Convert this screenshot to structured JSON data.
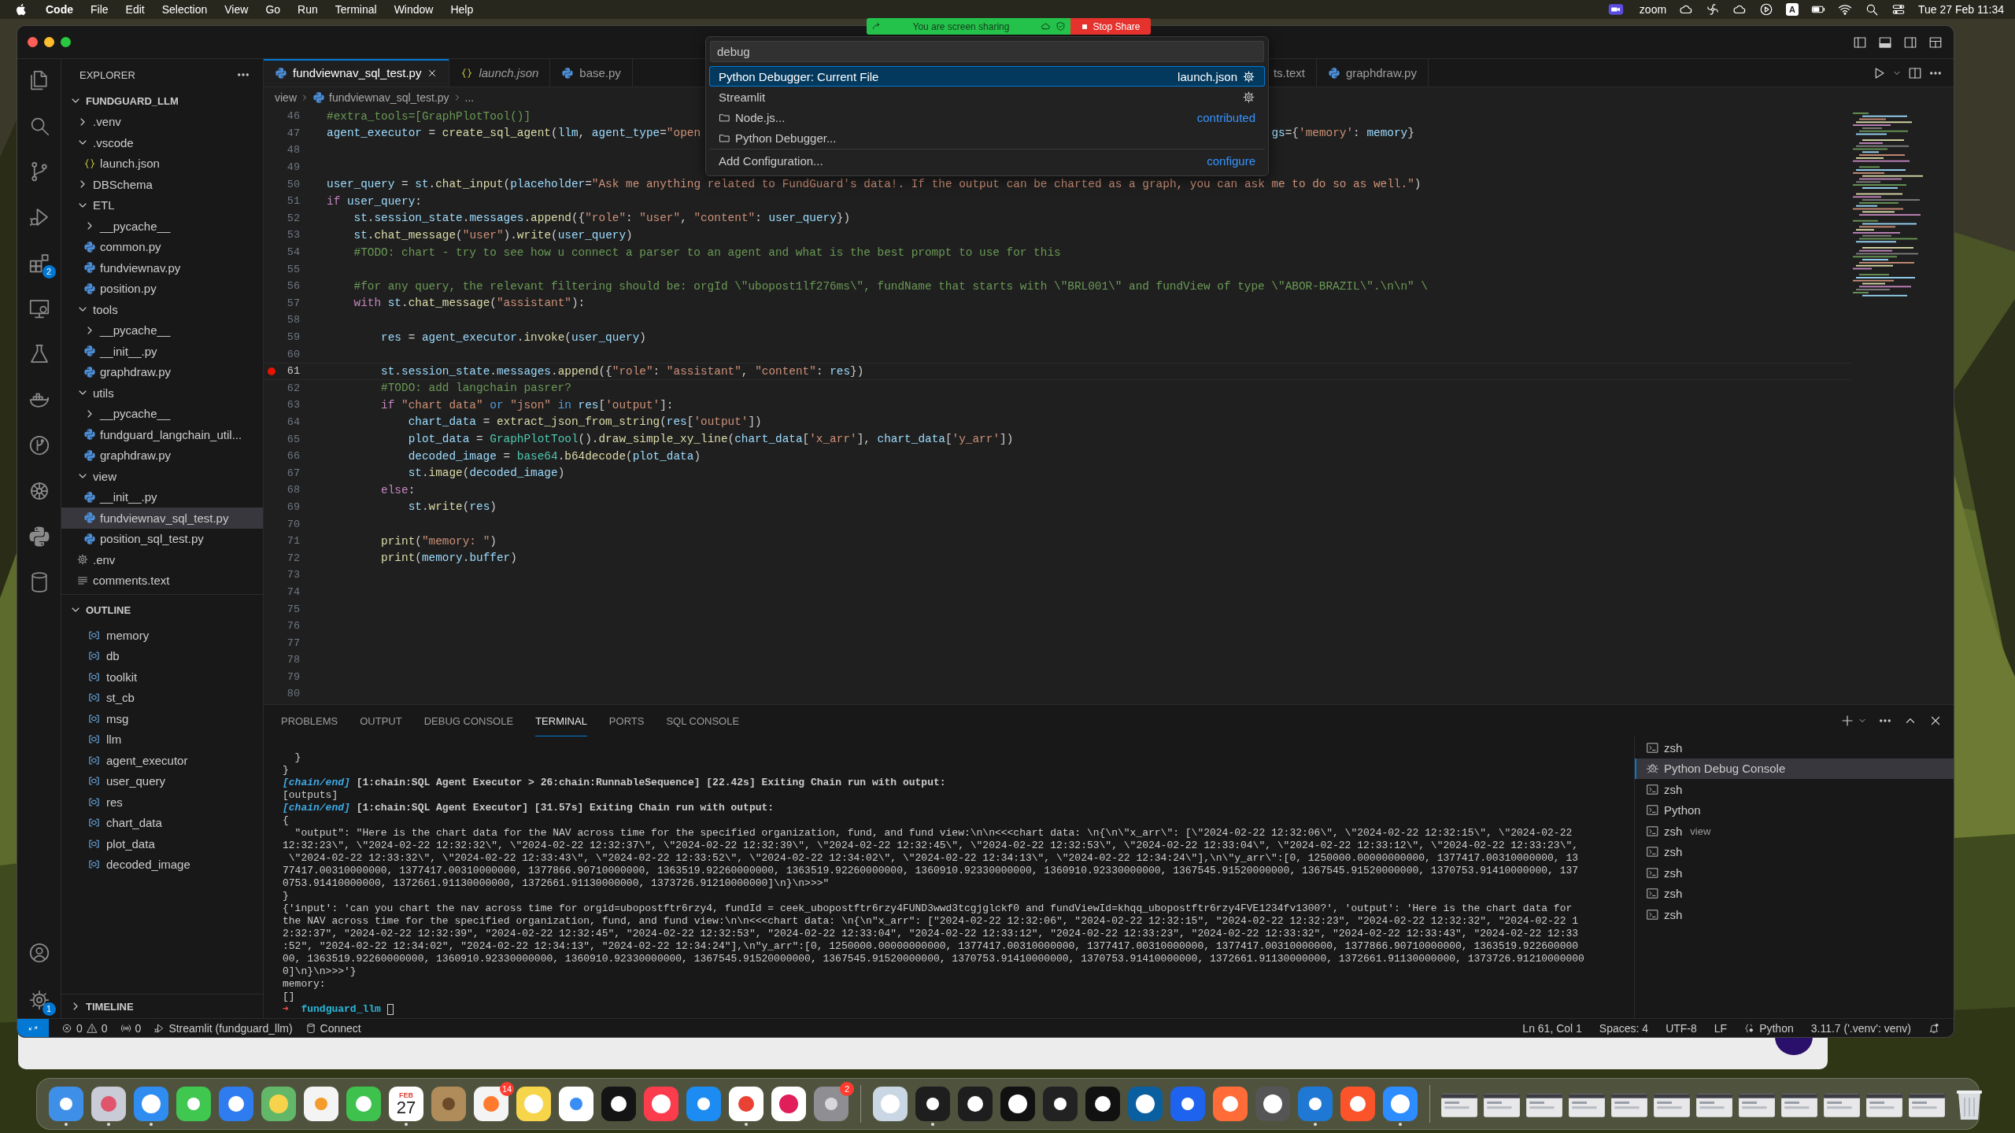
{
  "menu_bar": {
    "app": "Code",
    "menus": [
      "File",
      "Edit",
      "Selection",
      "View",
      "Go",
      "Run",
      "Terminal",
      "Window",
      "Help"
    ],
    "zoom_label": "zoom",
    "input_source": "A",
    "clock": "Tue 27 Feb 11:34"
  },
  "screen_share": {
    "message": "You are screen sharing",
    "stop_button": "Stop Share"
  },
  "activity_bar": {
    "extensions_badge": "2",
    "settings_badge": "1"
  },
  "explorer": {
    "title": "EXPLORER",
    "tree": {
      "label": "FUNDGUARD_LLM",
      "kind": "root",
      "expanded": true,
      "selected": false,
      "children": [
        {
          "label": ".venv",
          "kind": "folder",
          "expanded": false,
          "selected": false
        },
        {
          "label": ".vscode",
          "kind": "folder",
          "expanded": true,
          "selected": false,
          "children": [
            {
              "label": "launch.json",
              "kind": "json",
              "selected": false
            }
          ]
        },
        {
          "label": "DBSchema",
          "kind": "folder",
          "expanded": false,
          "selected": false
        },
        {
          "label": "ETL",
          "kind": "folder",
          "expanded": true,
          "selected": false,
          "children": [
            {
              "label": "__pycache__",
              "kind": "folder",
              "expanded": false,
              "selected": false
            },
            {
              "label": "common.py",
              "kind": "python",
              "selected": false
            },
            {
              "label": "fundviewnav.py",
              "kind": "python",
              "selected": false
            },
            {
              "label": "position.py",
              "kind": "python",
              "selected": false
            }
          ]
        },
        {
          "label": "tools",
          "kind": "folder",
          "expanded": true,
          "selected": false,
          "children": [
            {
              "label": "__pycache__",
              "kind": "folder",
              "expanded": false,
              "selected": false
            },
            {
              "label": "__init__.py",
              "kind": "python",
              "selected": false
            },
            {
              "label": "graphdraw.py",
              "kind": "python",
              "selected": false
            }
          ]
        },
        {
          "label": "utils",
          "kind": "folder",
          "expanded": true,
          "selected": false,
          "children": [
            {
              "label": "__pycache__",
              "kind": "folder",
              "expanded": false,
              "selected": false
            },
            {
              "label": "fundguard_langchain_util...",
              "kind": "python",
              "selected": false
            },
            {
              "label": "graphdraw.py",
              "kind": "python",
              "selected": false
            }
          ]
        },
        {
          "label": "view",
          "kind": "folder",
          "expanded": true,
          "selected": false,
          "children": [
            {
              "label": "__init__.py",
              "kind": "python",
              "selected": false
            },
            {
              "label": "fundviewnav_sql_test.py",
              "kind": "python",
              "selected": true
            },
            {
              "label": "position_sql_test.py",
              "kind": "python",
              "selected": false
            }
          ]
        },
        {
          "label": ".env",
          "kind": "env",
          "selected": false
        },
        {
          "label": "comments.text",
          "kind": "text",
          "selected": false
        }
      ]
    }
  },
  "outline": {
    "title": "OUTLINE",
    "expanded": true,
    "items": [
      "memory",
      "db",
      "toolkit",
      "st_cb",
      "msg",
      "llm",
      "agent_executor",
      "user_query",
      "res",
      "chart_data",
      "plot_data",
      "decoded_image"
    ]
  },
  "timeline": {
    "title": "TIMELINE",
    "expanded": false
  },
  "tabs": [
    {
      "label": "fundviewnav_sql_test.py",
      "kind": "python",
      "selected": true,
      "preview": false
    },
    {
      "label": "launch.json",
      "kind": "json",
      "selected": false,
      "preview": true
    },
    {
      "label": "base.py",
      "kind": "python",
      "selected": false,
      "preview": false
    },
    {
      "label": "ts.text",
      "kind": "partial",
      "selected": false,
      "preview": false
    },
    {
      "label": "graphdraw.py",
      "kind": "python",
      "selected": false,
      "preview": false
    }
  ],
  "breadcrumbs": [
    {
      "label": "view",
      "kind": "folder"
    },
    {
      "label": "fundviewnav_sql_test.py",
      "kind": "python"
    },
    {
      "label": "...",
      "kind": "symbol"
    }
  ],
  "command_palette": {
    "query": "debug",
    "items": [
      {
        "label": "Python Debugger: Current File",
        "detail": "launch.json",
        "kind": "config",
        "selected": true
      },
      {
        "label": "Streamlit",
        "kind": "config",
        "selected": false
      },
      {
        "label": "Node.js...",
        "detail": "contributed",
        "kind": "folder",
        "selected": false
      },
      {
        "label": "Python Debugger...",
        "kind": "folder",
        "selected": false
      },
      {
        "label": "Add Configuration...",
        "detail": "configure",
        "kind": "action",
        "selected": false
      }
    ]
  },
  "editor": {
    "lines": [
      {
        "number": "46",
        "breakpoint": false,
        "current": false,
        "tokens": [
          {
            "kind": "comment",
            "text": "#extra_tools=[GraphPlotTool()]"
          }
        ]
      },
      {
        "number": "47",
        "breakpoint": false,
        "current": false,
        "tokens": [
          {
            "kind": "variable",
            "text": "agent_executor"
          },
          {
            "kind": "plain",
            "text": " = "
          },
          {
            "kind": "function",
            "text": "create_sql_agent"
          },
          {
            "kind": "plain",
            "text": "("
          },
          {
            "kind": "variable",
            "text": "llm"
          },
          {
            "kind": "plain",
            "text": ", "
          },
          {
            "kind": "variable",
            "text": "agent_type"
          },
          {
            "kind": "plain",
            "text": "="
          },
          {
            "kind": "string",
            "text": "\"open"
          }
        ],
        "tokens_right": [
          {
            "kind": "variable",
            "text": "gs"
          },
          {
            "kind": "plain",
            "text": "={"
          },
          {
            "kind": "string",
            "text": "'memory'"
          },
          {
            "kind": "plain",
            "text": ": "
          },
          {
            "kind": "variable",
            "text": "memory"
          },
          {
            "kind": "plain",
            "text": "}"
          }
        ]
      },
      {
        "number": "48",
        "breakpoint": false,
        "current": false
      },
      {
        "number": "49",
        "breakpoint": false,
        "current": false
      },
      {
        "number": "50",
        "breakpoint": false,
        "current": false,
        "tokens": [
          {
            "kind": "variable",
            "text": "user_query"
          },
          {
            "kind": "plain",
            "text": " = "
          },
          {
            "kind": "variable",
            "text": "st"
          },
          {
            "kind": "plain",
            "text": "."
          },
          {
            "kind": "function",
            "text": "chat_input"
          },
          {
            "kind": "plain",
            "text": "("
          },
          {
            "kind": "variable",
            "text": "placeholder"
          },
          {
            "kind": "plain",
            "text": "="
          },
          {
            "kind": "string",
            "text": "\"Ask me anything related to FundGuard's data!. If the output can be charted as a graph, you can ask me to do so as well.\""
          },
          {
            "kind": "plain",
            "text": ")"
          }
        ]
      },
      {
        "number": "51",
        "breakpoint": false,
        "current": false,
        "tokens": [
          {
            "kind": "keyword",
            "text": "if "
          },
          {
            "kind": "variable",
            "text": "user_query"
          },
          {
            "kind": "plain",
            "text": ":"
          }
        ]
      },
      {
        "number": "52",
        "breakpoint": false,
        "current": false,
        "tokens": [
          {
            "kind": "variable",
            "text": "    st"
          },
          {
            "kind": "plain",
            "text": "."
          },
          {
            "kind": "variable",
            "text": "session_state"
          },
          {
            "kind": "plain",
            "text": "."
          },
          {
            "kind": "variable",
            "text": "messages"
          },
          {
            "kind": "plain",
            "text": "."
          },
          {
            "kind": "function",
            "text": "append"
          },
          {
            "kind": "plain",
            "text": "({"
          },
          {
            "kind": "string",
            "text": "\"role\""
          },
          {
            "kind": "plain",
            "text": ": "
          },
          {
            "kind": "string",
            "text": "\"user\""
          },
          {
            "kind": "plain",
            "text": ", "
          },
          {
            "kind": "string",
            "text": "\"content\""
          },
          {
            "kind": "plain",
            "text": ": "
          },
          {
            "kind": "variable",
            "text": "user_query"
          },
          {
            "kind": "plain",
            "text": "})"
          }
        ]
      },
      {
        "number": "53",
        "breakpoint": false,
        "current": false,
        "tokens": [
          {
            "kind": "variable",
            "text": "    st"
          },
          {
            "kind": "plain",
            "text": "."
          },
          {
            "kind": "function",
            "text": "chat_message"
          },
          {
            "kind": "plain",
            "text": "("
          },
          {
            "kind": "string",
            "text": "\"user\""
          },
          {
            "kind": "plain",
            "text": ")."
          },
          {
            "kind": "function",
            "text": "write"
          },
          {
            "kind": "plain",
            "text": "("
          },
          {
            "kind": "variable",
            "text": "user_query"
          },
          {
            "kind": "plain",
            "text": ")"
          }
        ]
      },
      {
        "number": "54",
        "breakpoint": false,
        "current": false,
        "tokens": [
          {
            "kind": "comment",
            "text": "    #TODO: chart - try to see how u connect a parser to an agent and what is the best prompt to use for this"
          }
        ]
      },
      {
        "number": "55",
        "breakpoint": false,
        "current": false
      },
      {
        "number": "56",
        "breakpoint": false,
        "current": false,
        "tokens": [
          {
            "kind": "comment",
            "text": "    #for any query, the relevant filtering should be: orgId \\\"ubopost1lf276ms\\\", fundName that starts with \\\"BRL001\\\" and fundView of type \\\"ABOR-BRAZIL\\\".\\n\\n\" \\"
          }
        ]
      },
      {
        "number": "57",
        "breakpoint": false,
        "current": false,
        "tokens": [
          {
            "kind": "keyword",
            "text": "    with "
          },
          {
            "kind": "variable",
            "text": "st"
          },
          {
            "kind": "plain",
            "text": "."
          },
          {
            "kind": "function",
            "text": "chat_message"
          },
          {
            "kind": "plain",
            "text": "("
          },
          {
            "kind": "string",
            "text": "\"assistant\""
          },
          {
            "kind": "plain",
            "text": "):"
          }
        ]
      },
      {
        "number": "58",
        "breakpoint": false,
        "current": false
      },
      {
        "number": "59",
        "breakpoint": false,
        "current": false,
        "tokens": [
          {
            "kind": "variable",
            "text": "        res"
          },
          {
            "kind": "plain",
            "text": " = "
          },
          {
            "kind": "variable",
            "text": "agent_executor"
          },
          {
            "kind": "plain",
            "text": "."
          },
          {
            "kind": "function",
            "text": "invoke"
          },
          {
            "kind": "plain",
            "text": "("
          },
          {
            "kind": "variable",
            "text": "user_query"
          },
          {
            "kind": "plain",
            "text": ")"
          }
        ]
      },
      {
        "number": "60",
        "breakpoint": false,
        "current": false
      },
      {
        "number": "61",
        "breakpoint": true,
        "current": true,
        "tokens": [
          {
            "kind": "variable",
            "text": "        st"
          },
          {
            "kind": "plain",
            "text": "."
          },
          {
            "kind": "variable",
            "text": "session_state"
          },
          {
            "kind": "plain",
            "text": "."
          },
          {
            "kind": "variable",
            "text": "messages"
          },
          {
            "kind": "plain",
            "text": "."
          },
          {
            "kind": "function",
            "text": "append"
          },
          {
            "kind": "plain",
            "text": "({"
          },
          {
            "kind": "string",
            "text": "\"role\""
          },
          {
            "kind": "plain",
            "text": ": "
          },
          {
            "kind": "string",
            "text": "\"assistant\""
          },
          {
            "kind": "plain",
            "text": ", "
          },
          {
            "kind": "string",
            "text": "\"content\""
          },
          {
            "kind": "plain",
            "text": ": "
          },
          {
            "kind": "variable",
            "text": "res"
          },
          {
            "kind": "plain",
            "text": "})"
          }
        ]
      },
      {
        "number": "62",
        "breakpoint": false,
        "current": false,
        "tokens": [
          {
            "kind": "comment",
            "text": "        #TODO: add langchain pasrer?"
          }
        ]
      },
      {
        "number": "63",
        "breakpoint": false,
        "current": false,
        "tokens": [
          {
            "kind": "keyword",
            "text": "        if "
          },
          {
            "kind": "string",
            "text": "\"chart data\""
          },
          {
            "kind": "operator",
            "text": " or "
          },
          {
            "kind": "string",
            "text": "\"json\""
          },
          {
            "kind": "operator",
            "text": " in "
          },
          {
            "kind": "variable",
            "text": "res"
          },
          {
            "kind": "plain",
            "text": "["
          },
          {
            "kind": "string",
            "text": "'output'"
          },
          {
            "kind": "plain",
            "text": "]:"
          }
        ]
      },
      {
        "number": "64",
        "breakpoint": false,
        "current": false,
        "tokens": [
          {
            "kind": "variable",
            "text": "            chart_data"
          },
          {
            "kind": "plain",
            "text": " = "
          },
          {
            "kind": "function",
            "text": "extract_json_from_string"
          },
          {
            "kind": "plain",
            "text": "("
          },
          {
            "kind": "variable",
            "text": "res"
          },
          {
            "kind": "plain",
            "text": "["
          },
          {
            "kind": "string",
            "text": "'output'"
          },
          {
            "kind": "plain",
            "text": "])"
          }
        ]
      },
      {
        "number": "65",
        "breakpoint": false,
        "current": false,
        "tokens": [
          {
            "kind": "variable",
            "text": "            plot_data"
          },
          {
            "kind": "plain",
            "text": " = "
          },
          {
            "kind": "class",
            "text": "GraphPlotTool"
          },
          {
            "kind": "plain",
            "text": "()."
          },
          {
            "kind": "function",
            "text": "draw_simple_xy_line"
          },
          {
            "kind": "plain",
            "text": "("
          },
          {
            "kind": "variable",
            "text": "chart_data"
          },
          {
            "kind": "plain",
            "text": "["
          },
          {
            "kind": "string",
            "text": "'x_arr'"
          },
          {
            "kind": "plain",
            "text": "], "
          },
          {
            "kind": "variable",
            "text": "chart_data"
          },
          {
            "kind": "plain",
            "text": "["
          },
          {
            "kind": "string",
            "text": "'y_arr'"
          },
          {
            "kind": "plain",
            "text": "])"
          }
        ]
      },
      {
        "number": "66",
        "breakpoint": false,
        "current": false,
        "tokens": [
          {
            "kind": "variable",
            "text": "            decoded_image"
          },
          {
            "kind": "plain",
            "text": " = "
          },
          {
            "kind": "class",
            "text": "base64"
          },
          {
            "kind": "plain",
            "text": "."
          },
          {
            "kind": "function",
            "text": "b64decode"
          },
          {
            "kind": "plain",
            "text": "("
          },
          {
            "kind": "variable",
            "text": "plot_data"
          },
          {
            "kind": "plain",
            "text": ")"
          }
        ]
      },
      {
        "number": "67",
        "breakpoint": false,
        "current": false,
        "tokens": [
          {
            "kind": "variable",
            "text": "            st"
          },
          {
            "kind": "plain",
            "text": "."
          },
          {
            "kind": "function",
            "text": "image"
          },
          {
            "kind": "plain",
            "text": "("
          },
          {
            "kind": "variable",
            "text": "decoded_image"
          },
          {
            "kind": "plain",
            "text": ")"
          }
        ]
      },
      {
        "number": "68",
        "breakpoint": false,
        "current": false,
        "tokens": [
          {
            "kind": "keyword",
            "text": "        else"
          },
          {
            "kind": "plain",
            "text": ":"
          }
        ]
      },
      {
        "number": "69",
        "breakpoint": false,
        "current": false,
        "tokens": [
          {
            "kind": "variable",
            "text": "            st"
          },
          {
            "kind": "plain",
            "text": "."
          },
          {
            "kind": "function",
            "text": "write"
          },
          {
            "kind": "plain",
            "text": "("
          },
          {
            "kind": "variable",
            "text": "res"
          },
          {
            "kind": "plain",
            "text": ")"
          }
        ]
      },
      {
        "number": "70",
        "breakpoint": false,
        "current": false
      },
      {
        "number": "71",
        "breakpoint": false,
        "current": false,
        "tokens": [
          {
            "kind": "function",
            "text": "        print"
          },
          {
            "kind": "plain",
            "text": "("
          },
          {
            "kind": "string",
            "text": "\"memory: \""
          },
          {
            "kind": "plain",
            "text": ")"
          }
        ]
      },
      {
        "number": "72",
        "breakpoint": false,
        "current": false,
        "tokens": [
          {
            "kind": "function",
            "text": "        print"
          },
          {
            "kind": "plain",
            "text": "("
          },
          {
            "kind": "variable",
            "text": "memory"
          },
          {
            "kind": "plain",
            "text": "."
          },
          {
            "kind": "variable",
            "text": "buffer"
          },
          {
            "kind": "plain",
            "text": ")"
          }
        ]
      },
      {
        "number": "73",
        "breakpoint": false,
        "current": false
      },
      {
        "number": "74",
        "breakpoint": false,
        "current": false
      },
      {
        "number": "75",
        "breakpoint": false,
        "current": false
      },
      {
        "number": "76",
        "breakpoint": false,
        "current": false
      },
      {
        "number": "77",
        "breakpoint": false,
        "current": false
      },
      {
        "number": "78",
        "breakpoint": false,
        "current": false
      },
      {
        "number": "79",
        "breakpoint": false,
        "current": false
      },
      {
        "number": "80",
        "breakpoint": false,
        "current": false
      }
    ]
  },
  "panel": {
    "tabs": [
      {
        "label": "PROBLEMS",
        "selected": false
      },
      {
        "label": "OUTPUT",
        "selected": false
      },
      {
        "label": "DEBUG CONSOLE",
        "selected": false
      },
      {
        "label": "TERMINAL",
        "selected": true
      },
      {
        "label": "PORTS",
        "selected": false
      },
      {
        "label": "SQL CONSOLE",
        "selected": false
      }
    ]
  },
  "terminal": {
    "lines": [
      {
        "kind": "text",
        "text": "  }"
      },
      {
        "kind": "text",
        "text": "}"
      },
      {
        "kind": "log",
        "tag": "[chain/end]",
        "text": " [1:chain:SQL Agent Executor > 26:chain:RunnableSequence] [22.42s] Exiting Chain run with output:"
      },
      {
        "kind": "text",
        "text": "[outputs]"
      },
      {
        "kind": "log",
        "tag": "[chain/end]",
        "text": " [1:chain:SQL Agent Executor] [31.57s] Exiting Chain run with output:"
      },
      {
        "kind": "text",
        "text": "{"
      },
      {
        "kind": "text",
        "text": "  \"output\": \"Here is the chart data for the NAV across time for the specified organization, fund, and fund view:\\n\\n<<<chart data: \\n{\\n\\\"x_arr\\\": [\\\"2024-02-22 12:32:06\\\", \\\"2024-02-22 12:32:15\\\", \\\"2024-02-22"
      },
      {
        "kind": "text",
        "text": "12:32:23\\\", \\\"2024-02-22 12:32:32\\\", \\\"2024-02-22 12:32:37\\\", \\\"2024-02-22 12:32:39\\\", \\\"2024-02-22 12:32:45\\\", \\\"2024-02-22 12:32:53\\\", \\\"2024-02-22 12:33:04\\\", \\\"2024-02-22 12:33:12\\\", \\\"2024-02-22 12:33:23\\\","
      },
      {
        "kind": "text",
        "text": " \\\"2024-02-22 12:33:32\\\", \\\"2024-02-22 12:33:43\\\", \\\"2024-02-22 12:33:52\\\", \\\"2024-02-22 12:34:02\\\", \\\"2024-02-22 12:34:13\\\", \\\"2024-02-22 12:34:24\\\"],\\n\\\"y_arr\\\":[0, 1250000.00000000000, 1377417.00310000000, 13"
      },
      {
        "kind": "text",
        "text": "77417.00310000000, 1377417.00310000000, 1377866.90710000000, 1363519.92260000000, 1363519.92260000000, 1360910.92330000000, 1360910.92330000000, 1367545.91520000000, 1367545.91520000000, 1370753.91410000000, 137"
      },
      {
        "kind": "text",
        "text": "0753.91410000000, 1372661.91130000000, 1372661.91130000000, 1373726.91210000000]\\n}\\n>>>\""
      },
      {
        "kind": "text",
        "text": "}"
      },
      {
        "kind": "text",
        "text": "{'input': 'can you chart the nav across time for orgid=ubopostftr6rzy4, fundId = ceek_ubopostftr6rzy4FUND3wwd3tcgjglckf0 and fundViewId=khqq_ubopostftr6rzy4FVE1234fv1300?', 'output': 'Here is the chart data for"
      },
      {
        "kind": "text",
        "text": "the NAV across time for the specified organization, fund, and fund view:\\n\\n<<<chart data: \\n{\\n\"x_arr\": [\"2024-02-22 12:32:06\", \"2024-02-22 12:32:15\", \"2024-02-22 12:32:23\", \"2024-02-22 12:32:32\", \"2024-02-22 1"
      },
      {
        "kind": "text",
        "text": "2:32:37\", \"2024-02-22 12:32:39\", \"2024-02-22 12:32:45\", \"2024-02-22 12:32:53\", \"2024-02-22 12:33:04\", \"2024-02-22 12:33:12\", \"2024-02-22 12:33:23\", \"2024-02-22 12:33:32\", \"2024-02-22 12:33:43\", \"2024-02-22 12:33"
      },
      {
        "kind": "text",
        "text": ":52\", \"2024-02-22 12:34:02\", \"2024-02-22 12:34:13\", \"2024-02-22 12:34:24\"],\\n\"y_arr\":[0, 1250000.00000000000, 1377417.00310000000, 1377417.00310000000, 1377417.00310000000, 1377866.90710000000, 1363519.922600000"
      },
      {
        "kind": "text",
        "text": "00, 1363519.92260000000, 1360910.92330000000, 1360910.92330000000, 1367545.91520000000, 1367545.91520000000, 1370753.91410000000, 1370753.91410000000, 1372661.91130000000, 1372661.91130000000, 1373726.91210000000"
      },
      {
        "kind": "text",
        "text": "0]\\n}\\n>>>'}"
      },
      {
        "kind": "text",
        "text": "memory:"
      },
      {
        "kind": "text",
        "text": "[]"
      },
      {
        "kind": "prompt",
        "arrow": "➜",
        "text": "fundguard_llm"
      }
    ]
  },
  "terminal_list": [
    {
      "label": "zsh",
      "kind": "shell",
      "selected": false
    },
    {
      "label": "Python Debug Console",
      "kind": "debug",
      "selected": true
    },
    {
      "label": "zsh",
      "kind": "shell",
      "selected": false
    },
    {
      "label": "Python",
      "kind": "shell",
      "selected": false
    },
    {
      "label": "zsh",
      "description": "view",
      "kind": "shell",
      "selected": false
    },
    {
      "label": "zsh",
      "kind": "shell",
      "selected": false
    },
    {
      "label": "zsh",
      "kind": "shell",
      "selected": false
    },
    {
      "label": "zsh",
      "kind": "shell",
      "selected": false
    },
    {
      "label": "zsh",
      "kind": "shell",
      "selected": false
    }
  ],
  "status_bar": {
    "errors": "0",
    "warnings": "0",
    "ports": "0",
    "debug_target": "Streamlit (fundguard_llm)",
    "connect": "Connect",
    "position": "Ln 61, Col 1",
    "indentation": "Spaces: 4",
    "encoding": "UTF-8",
    "eol": "LF",
    "language": "Python",
    "interpreter": "3.11.7 ('.venv': venv)"
  },
  "dock": {
    "calendar_month": "FEB",
    "calendar_day": "27",
    "reminders_badge": "14",
    "settings_badge": "2"
  }
}
